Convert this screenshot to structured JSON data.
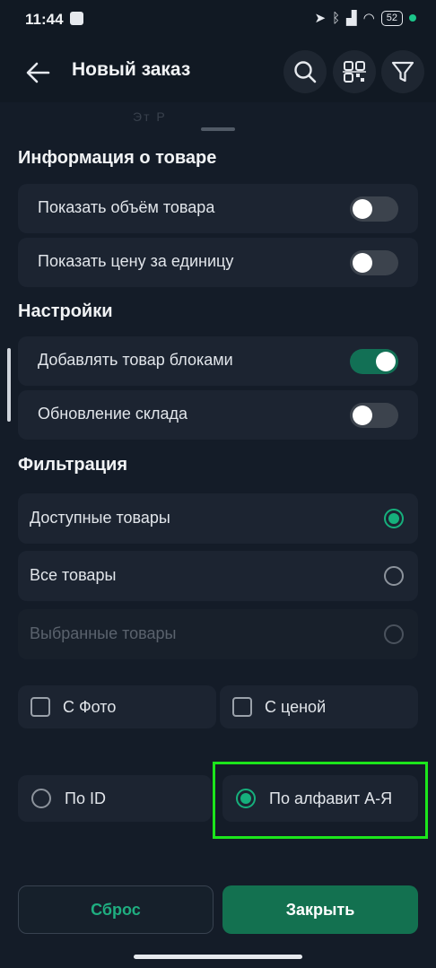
{
  "status_bar": {
    "time": "11:44",
    "battery": "52"
  },
  "header": {
    "title": "Новый заказ"
  },
  "sheet": {
    "ghost_text": "Эт Р",
    "sections": {
      "product_info": "Информация о товаре",
      "settings": "Настройки",
      "filter": "Фильтрация"
    },
    "product_info_rows": [
      {
        "label": "Показать объём товара",
        "on": false
      },
      {
        "label": "Показать цену за единицу",
        "on": false
      }
    ],
    "settings_rows": [
      {
        "label": "Добавлять товар блоками",
        "on": true
      },
      {
        "label": "Обновление склада",
        "on": false
      }
    ],
    "filter_options": [
      {
        "label": "Доступные товары",
        "selected": true,
        "disabled": false
      },
      {
        "label": "Все товары",
        "selected": false,
        "disabled": false
      },
      {
        "label": "Выбранные товары",
        "selected": false,
        "disabled": true
      }
    ],
    "checkboxes": [
      {
        "label": "С Фото",
        "checked": false
      },
      {
        "label": "С ценой",
        "checked": false
      }
    ],
    "sort_options": [
      {
        "label": "По ID",
        "selected": false
      },
      {
        "label": "По алфавит А-Я",
        "selected": true
      }
    ],
    "buttons": {
      "reset": "Сброс",
      "close": "Закрыть"
    }
  },
  "colors": {
    "accent": "#16b07c",
    "highlight": "#1ce61c",
    "background": "#141c28"
  }
}
